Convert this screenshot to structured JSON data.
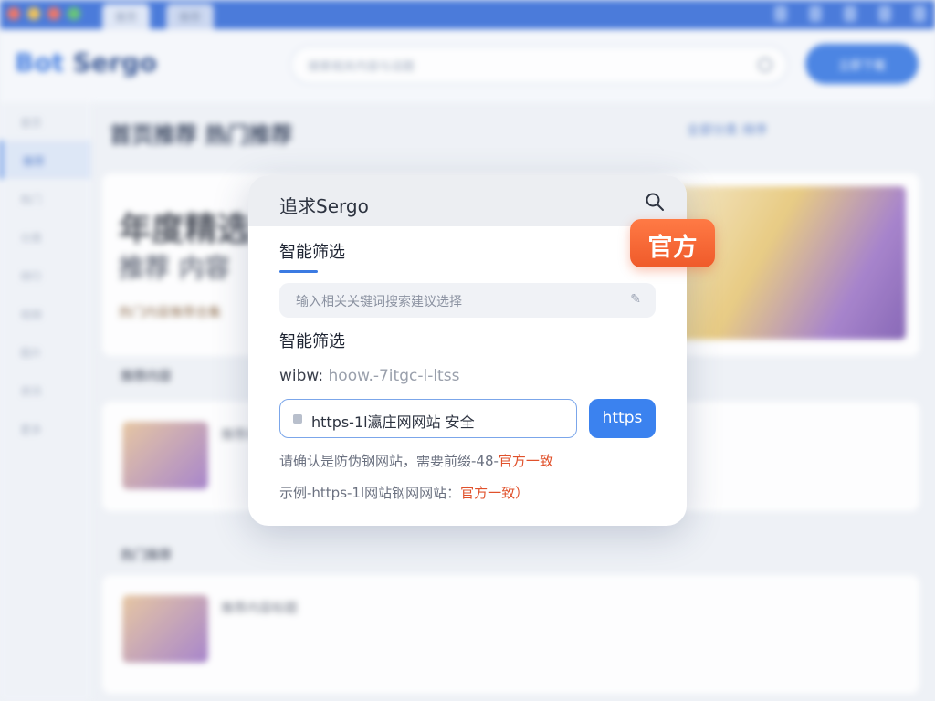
{
  "overlay": {
    "title": "追求Sergo",
    "badge": "官方",
    "tab_active": "智能筛选",
    "hint_placeholder": "输入相关关键词搜索建议选择",
    "section_title": "智能筛选",
    "www_label": "wibw:",
    "www_value": "hoow.-7itgc-l-ltss",
    "url_value": "https-1l瀛庄网网站 安全",
    "go_button": "https",
    "note1_prefix": "请确认是防伪钢网站，需要前缀-48-",
    "note1_highlight": "官方一致",
    "note2_prefix": "示例-https-1l网站钢网网站：",
    "note2_highlight": "官方一致）"
  },
  "background": {
    "logo": "Sergo",
    "logo_mark": "Bot",
    "search_placeholder": "搜索相关内容与话题",
    "header_button": "立即下载",
    "tabs": [
      "首页",
      "推荐"
    ],
    "sidebar": [
      "首页",
      "推荐",
      "热门",
      "分类",
      "排行",
      "视频",
      "图片",
      "资讯",
      "更多"
    ],
    "breadcrumb": "首页推荐 热门推荐",
    "breadcrumb_right": "全部分类 排序",
    "hero_title": "年度精选",
    "hero_sub": "推荐 内容",
    "hero_small": "热门内容推荐合集",
    "section1": "推荐内容",
    "section2": "热门推荐",
    "row_text": "推荐内容标题"
  },
  "colors": {
    "accent": "#3b82ef",
    "badge": "#ef5a2a",
    "highlight_text": "#e0512b"
  }
}
